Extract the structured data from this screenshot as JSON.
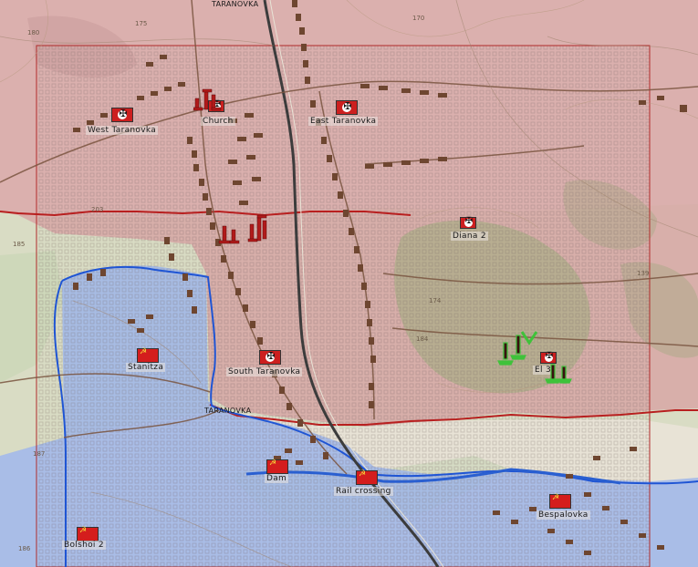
{
  "map": {
    "locations": [
      {
        "id": "west-taranovka",
        "label": "West Taranovka",
        "side": "german"
      },
      {
        "id": "church",
        "label": "Church",
        "side": "german"
      },
      {
        "id": "east-taranovka",
        "label": "East Taranovka",
        "side": "german"
      },
      {
        "id": "diana-2",
        "label": "Diana 2",
        "side": "german"
      },
      {
        "id": "south-taranovka",
        "label": "South Taranovka",
        "side": "german"
      },
      {
        "id": "el-3",
        "label": "El 3",
        "side": "german"
      },
      {
        "id": "stanitza",
        "label": "Stanitza",
        "side": "soviet"
      },
      {
        "id": "dam",
        "label": "Dam",
        "side": "soviet"
      },
      {
        "id": "rail-crossing",
        "label": "Rail crossing",
        "side": "soviet"
      },
      {
        "id": "bespalovka",
        "label": "Bespalovka",
        "side": "soviet"
      },
      {
        "id": "bolshoi-2",
        "label": "Bolshoi 2",
        "side": "soviet"
      }
    ],
    "town_labels": [
      {
        "id": "taranovka-top",
        "label": "TARANOVKA"
      },
      {
        "id": "taranovka-mid",
        "label": "TARANOVKA"
      }
    ],
    "contour_numbers": [
      "180",
      "175",
      "170",
      "203",
      "185",
      "174",
      "184",
      "139",
      "187",
      "186"
    ],
    "colors": {
      "german_zone": "#d7a8a8",
      "soviet_zone": "#9fb7e6",
      "german_unit": "#b11a1a",
      "soviet_unit": "#3fc23a",
      "front_line_red": "#b81f1f",
      "front_line_blue": "#1f55d4",
      "buildings": "#6e4630",
      "roads": "#7a5540",
      "river": "#2a5fd0"
    },
    "icons": [
      "german-flag-icon",
      "soviet-flag-icon",
      "german-unit-icon",
      "soviet-unit-icon"
    ]
  }
}
